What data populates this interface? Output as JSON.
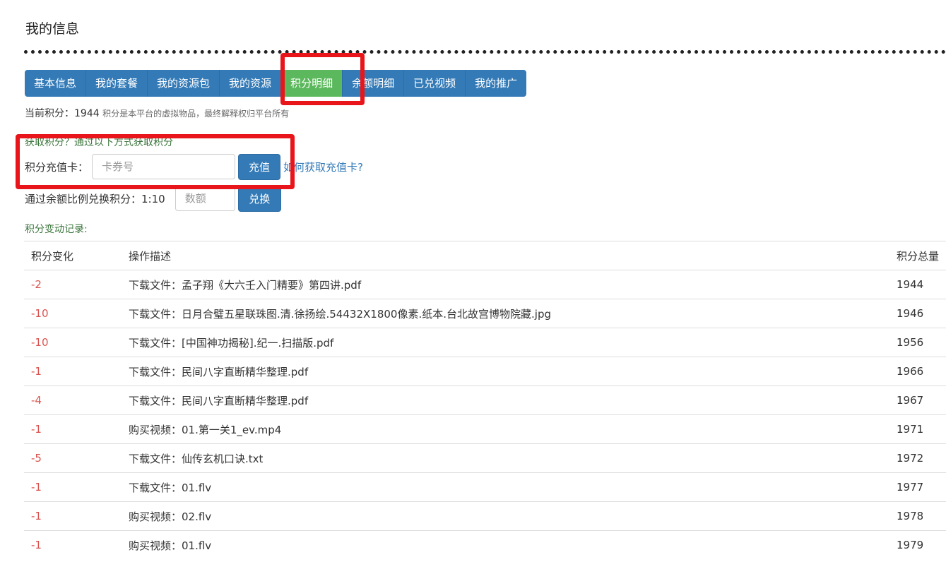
{
  "page_title": "我的信息",
  "tabs": [
    {
      "label": "基本信息",
      "active": false
    },
    {
      "label": "我的套餐",
      "active": false
    },
    {
      "label": "我的资源包",
      "active": false
    },
    {
      "label": "我的资源",
      "active": false
    },
    {
      "label": "积分明细",
      "active": true
    },
    {
      "label": "余额明细",
      "active": false
    },
    {
      "label": "已兑视频",
      "active": false
    },
    {
      "label": "我的推广",
      "active": false
    }
  ],
  "points": {
    "label": "当前积分：",
    "value": "1944",
    "note": "积分是本平台的虚拟物品，最终解释权归平台所有"
  },
  "earn": {
    "title": "获取积分？通过以下方式获取积分",
    "recharge_label": "积分充值卡：",
    "card_placeholder": "卡券号",
    "recharge_button": "充值",
    "how_link": "如何获取充值卡?"
  },
  "exchange": {
    "label": "通过余额比例兑换积分：",
    "ratio": "1:10",
    "amount_placeholder": "数额",
    "button": "兑换"
  },
  "log": {
    "title": "积分变动记录:",
    "headers": {
      "change": "积分变化",
      "desc": "操作描述",
      "total": "积分总量"
    },
    "rows": [
      {
        "change": "-2",
        "desc": "下载文件：孟子翔《大六壬入门精要》第四讲.pdf",
        "total": "1944"
      },
      {
        "change": "-10",
        "desc": "下载文件：日月合璧五星联珠图.清.徐扬绘.54432X1800像素.纸本.台北故宫博物院藏.jpg",
        "total": "1946"
      },
      {
        "change": "-10",
        "desc": "下载文件：[中国神功揭秘].纪一.扫描版.pdf",
        "total": "1956"
      },
      {
        "change": "-1",
        "desc": "下载文件：民间八字直断精华整理.pdf",
        "total": "1966"
      },
      {
        "change": "-4",
        "desc": "下载文件：民间八字直断精华整理.pdf",
        "total": "1967"
      },
      {
        "change": "-1",
        "desc": "购买视频：01.第一关1_ev.mp4",
        "total": "1971"
      },
      {
        "change": "-5",
        "desc": "下载文件：仙传玄机口诀.txt",
        "total": "1972"
      },
      {
        "change": "-1",
        "desc": "下载文件：01.flv",
        "total": "1977"
      },
      {
        "change": "-1",
        "desc": "购买视频：02.flv",
        "total": "1978"
      },
      {
        "change": "-1",
        "desc": "购买视频：01.flv",
        "total": "1979"
      }
    ]
  },
  "colors": {
    "primary": "#337ab7",
    "active_tab": "#5cb85c",
    "highlight": "#e8161b",
    "negative": "#d9534f",
    "green_text": "#3c763d"
  }
}
